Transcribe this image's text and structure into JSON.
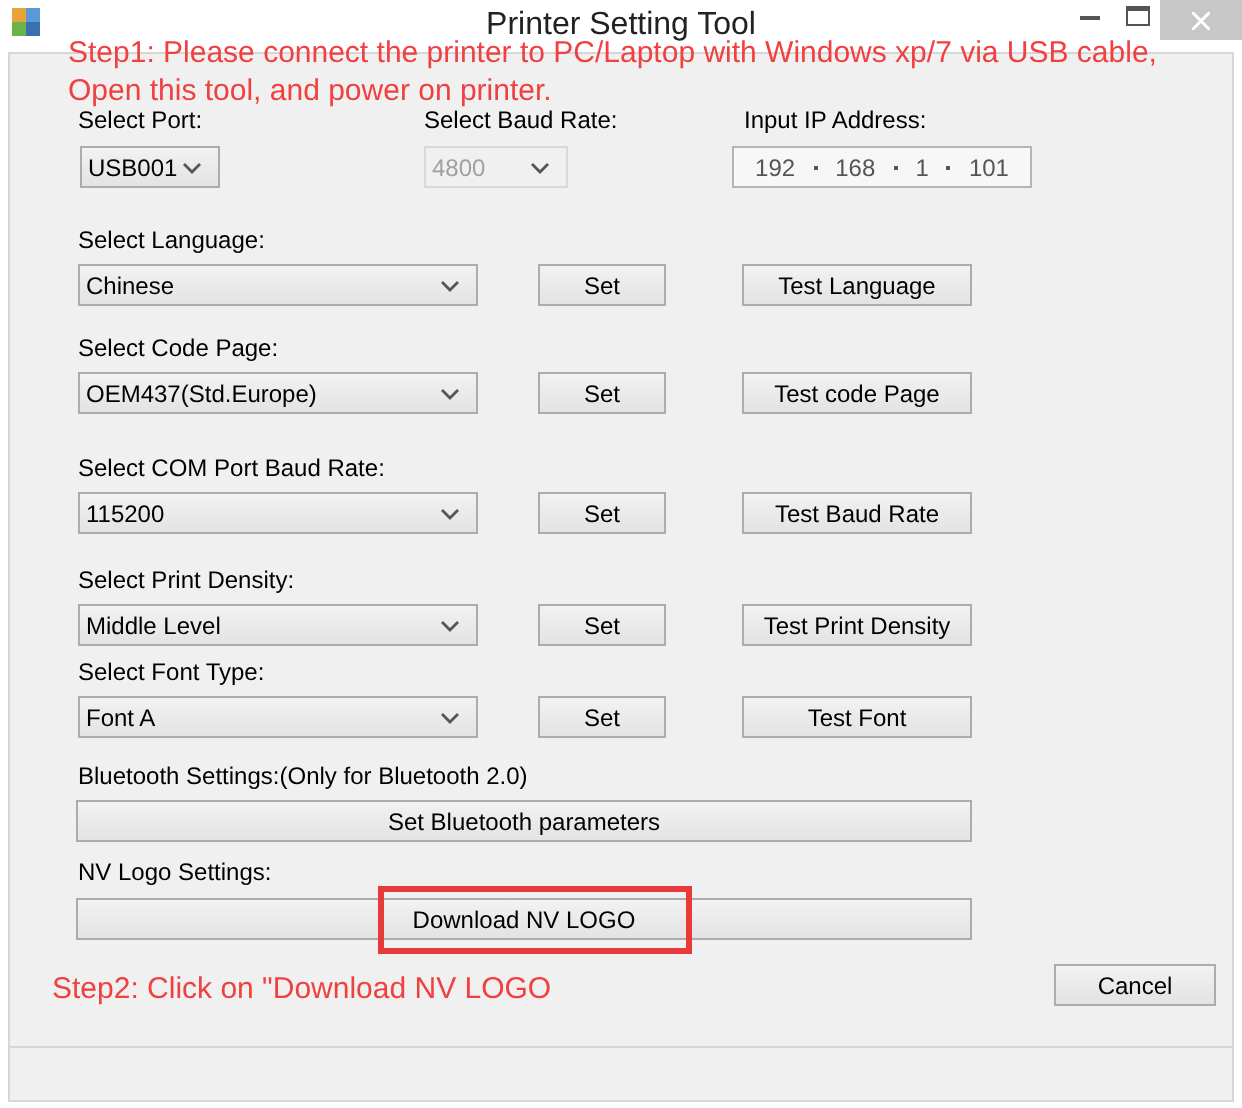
{
  "window": {
    "title": "Printer Setting Tool"
  },
  "step1": {
    "lines": [
      "Step1: Please connect the printer to PC/Laptop with Windows xp/7 via USB cable,",
      "Open this tool, and power on printer."
    ]
  },
  "port": {
    "label": "Select Port:",
    "value": "USB001",
    "disabled": false
  },
  "baud_rate": {
    "label": "Select Baud Rate:",
    "value": "4800",
    "disabled": true
  },
  "ip_address": {
    "label": "Input IP Address:",
    "octets": [
      "192",
      "168",
      "1",
      "101"
    ]
  },
  "settings": [
    {
      "label": "Select Language:",
      "value": "Chinese",
      "set_button": "Set",
      "test_button": "Test Language"
    },
    {
      "label": "Select Code Page:",
      "value": "OEM437(Std.Europe)",
      "set_button": "Set",
      "test_button": "Test code Page"
    },
    {
      "label": "Select COM Port Baud Rate:",
      "value": "115200",
      "set_button": "Set",
      "test_button": "Test Baud Rate"
    },
    {
      "label": "Select Print Density:",
      "value": "Middle Level",
      "set_button": "Set",
      "test_button": "Test Print Density"
    },
    {
      "label": "Select Font Type:",
      "value": "Font A",
      "set_button": "Set",
      "test_button": "Test Font"
    }
  ],
  "bluetooth": {
    "label": "Bluetooth Settings:(Only for Bluetooth 2.0)",
    "button": "Set Bluetooth parameters"
  },
  "nv_logo": {
    "label": "NV Logo Settings:",
    "button": "Download NV LOGO",
    "highlighted": true
  },
  "step2": {
    "text": "Step2: Click on \"Download NV LOGO"
  },
  "cancel_button": "Cancel"
}
